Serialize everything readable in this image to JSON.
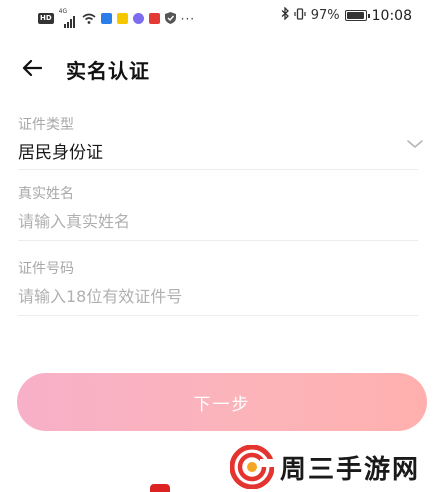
{
  "status_bar": {
    "left_badge": "HD",
    "signal": "4G",
    "icons": [
      "wifi-icon",
      "shield-app-icon",
      "notes-app-icon",
      "music-app-icon",
      "red-app-icon",
      "shield-check-icon"
    ],
    "more": "···",
    "battery_percent": "97%",
    "battery_level": 0.97,
    "time": "10:08"
  },
  "header": {
    "back_icon": "arrow-left-icon",
    "title": "实名认证"
  },
  "form": {
    "id_type": {
      "label": "证件类型",
      "value": "居民身份证",
      "icon": "chevron-down-icon"
    },
    "real_name": {
      "label": "真实姓名",
      "placeholder": "请输入真实姓名",
      "value": ""
    },
    "id_number": {
      "label": "证件号码",
      "placeholder": "请输入18位有效证件号",
      "value": ""
    }
  },
  "next_button": {
    "label": "下一步"
  },
  "watermark": {
    "text": "周三手游网",
    "colors": {
      "ring": "#e3342f",
      "ring_inner": "#f5a623"
    }
  },
  "colors": {
    "button_gradient_start": "#f7b0c8",
    "button_gradient_end": "#ffb0ae",
    "label_gray": "#a8a8a8",
    "divider": "#ececec"
  }
}
